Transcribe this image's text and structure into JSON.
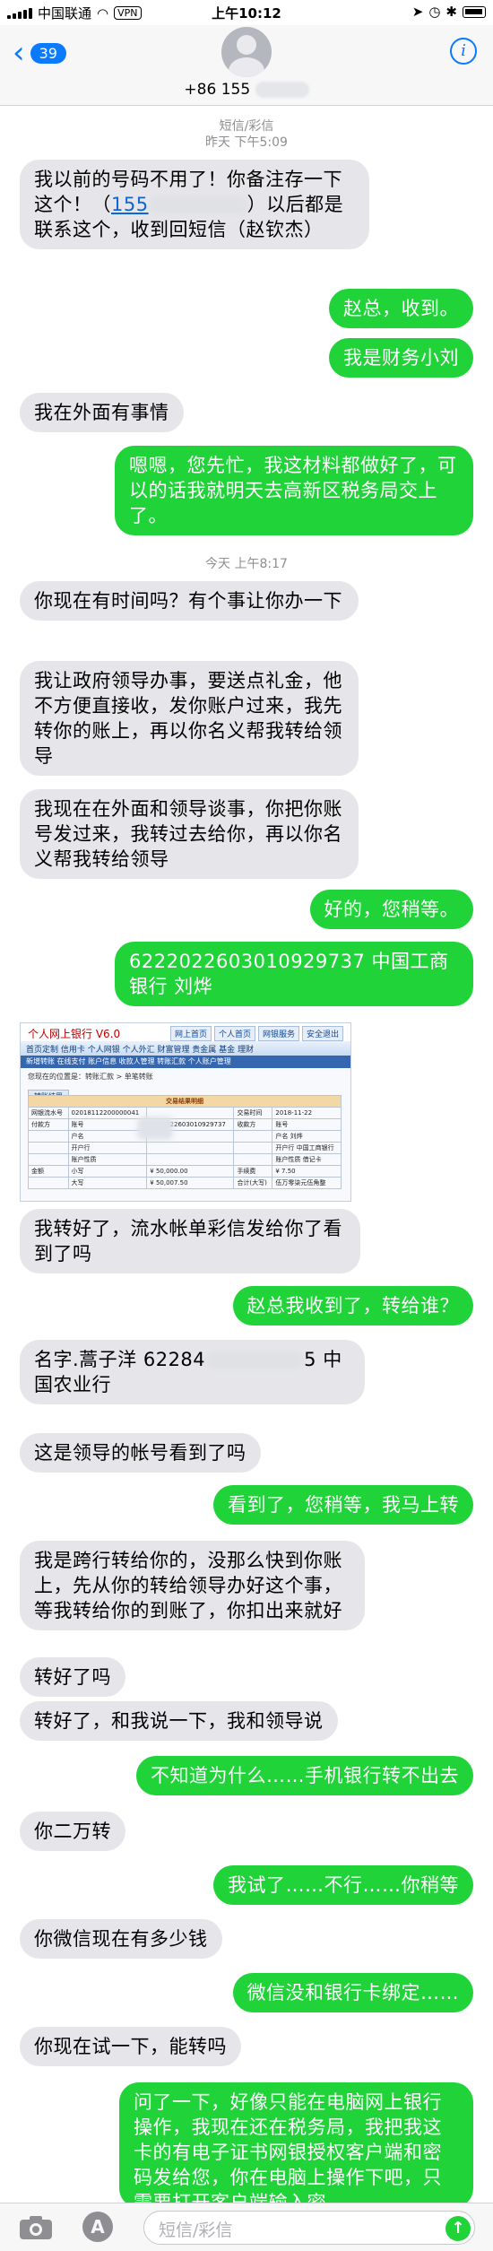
{
  "status_bar": {
    "carrier": "中国联通",
    "vpn": "VPN",
    "time": "上午10:12",
    "icons": [
      "signal-icon",
      "wifi-icon",
      "vpn-badge",
      "location-icon",
      "alarm-icon",
      "bluetooth-icon",
      "battery-icon"
    ]
  },
  "header": {
    "back_count": "39",
    "back_icon": "chevron-left-icon",
    "number": "+86 155",
    "info_icon": "info-icon"
  },
  "sections": [
    {
      "title": "短信/彩信",
      "time": "昨天 下午5:09"
    },
    {
      "title": "",
      "time": "今天 上午8:17"
    }
  ],
  "messages": [
    {
      "dir": "in",
      "text_a": "我以前的号码不用了！你备注存一下这个！（",
      "link": "155",
      "text_b": "）以后都是联系这个，收到回短信（赵钦杰）"
    },
    {
      "dir": "out",
      "text": "赵总，收到。"
    },
    {
      "dir": "out",
      "text": "我是财务小刘"
    },
    {
      "dir": "in",
      "text": "我在外面有事情"
    },
    {
      "dir": "out",
      "text": "嗯嗯，您先忙，我这材料都做好了，可以的话我就明天去高新区税务局交上了。"
    },
    {
      "dir": "in",
      "text": "你现在有时间吗？有个事让你办一下"
    },
    {
      "dir": "in",
      "text": "我让政府领导办事，要送点礼金，他不方便直接收，发你账户过来，我先转你的账上，再以你名义帮我转给领导"
    },
    {
      "dir": "in",
      "text": "我现在在外面和领导谈事，你把你账号发过来，我转过去给你，再以你名义帮我转给领导"
    },
    {
      "dir": "out",
      "text": "好的，您稍等。"
    },
    {
      "dir": "out",
      "text": "6222022603010929737 中国工商银行 刘烨"
    },
    {
      "dir": "in",
      "text": "我转好了，流水帐单彩信发给你了看到了吗"
    },
    {
      "dir": "out",
      "text": "赵总我收到了，转给谁？"
    },
    {
      "dir": "in",
      "text_a": "名字.蒿子洋 62284",
      "text_b": "5 中国农业行"
    },
    {
      "dir": "in",
      "text": "这是领导的帐号看到了吗"
    },
    {
      "dir": "out",
      "text": "看到了，您稍等，我马上转"
    },
    {
      "dir": "in",
      "text": "我是跨行转给你的，没那么快到你账上，先从你的转给领导办好这个事，等我转给你的到账了，你扣出来就好"
    },
    {
      "dir": "in",
      "text": "转好了吗"
    },
    {
      "dir": "in",
      "text": "转好了，和我说一下，我和领导说"
    },
    {
      "dir": "out",
      "text": "不知道为什么……手机银行转不出去"
    },
    {
      "dir": "in",
      "text": "你二万转"
    },
    {
      "dir": "out",
      "text": "我试了……不行……你稍等"
    },
    {
      "dir": "in",
      "text": "你微信现在有多少钱"
    },
    {
      "dir": "out",
      "text": "微信没和银行卡绑定……"
    },
    {
      "dir": "in",
      "text": "你现在试一下，能转吗"
    },
    {
      "dir": "out",
      "text": "问了一下，好像只能在电脑网上银行操作，我现在还在税务局，我把我这卡的有电子证书网银授权客户端和密码发给您，你在电脑上操作下吧，只需要打开客户端输入密"
    }
  ],
  "bank_screenshot": {
    "title": "个人网上银行",
    "version": "V6.0",
    "tabs": [
      "网上首页",
      "个人首页",
      "网银服务",
      "安全退出"
    ],
    "nav": "首页定制   信用卡   个人网银   个人外汇   财富管理   贵金属   基金   理财",
    "nav2": "新增转账   在线支付   账户信息   收款人管理   转账汇款   个人账户管理",
    "crumb": "您现在的位置是：转账汇款 > 单笔转账",
    "tag": "转账结果",
    "table_title": "交易结果明细",
    "rows": [
      [
        "网银流水号",
        "02018112200000041",
        "",
        "交易时间",
        "2018-11-22"
      ],
      [
        "付款方",
        "账号",
        "6222022603010929737",
        "收款方",
        "账号"
      ],
      [
        "",
        "户名",
        "",
        "",
        "户名  刘烨"
      ],
      [
        "",
        "开户行",
        "",
        "",
        "开户行  中国工商银行"
      ],
      [
        "",
        "账户性质",
        "",
        "",
        "账户性质  借记卡"
      ],
      [
        "金额",
        "小写",
        "¥ 50,000.00",
        "手续费",
        "¥ 7.50"
      ],
      [
        "",
        "大写",
        "¥ 50,007.50",
        "合计(大写)",
        "伍万零柒元伍角整"
      ]
    ]
  },
  "bottom_bar": {
    "camera_icon": "camera-icon",
    "apps_icon": "app-store-icon",
    "input_placeholder": "短信/彩信",
    "send_icon": "send-arrow-icon"
  }
}
